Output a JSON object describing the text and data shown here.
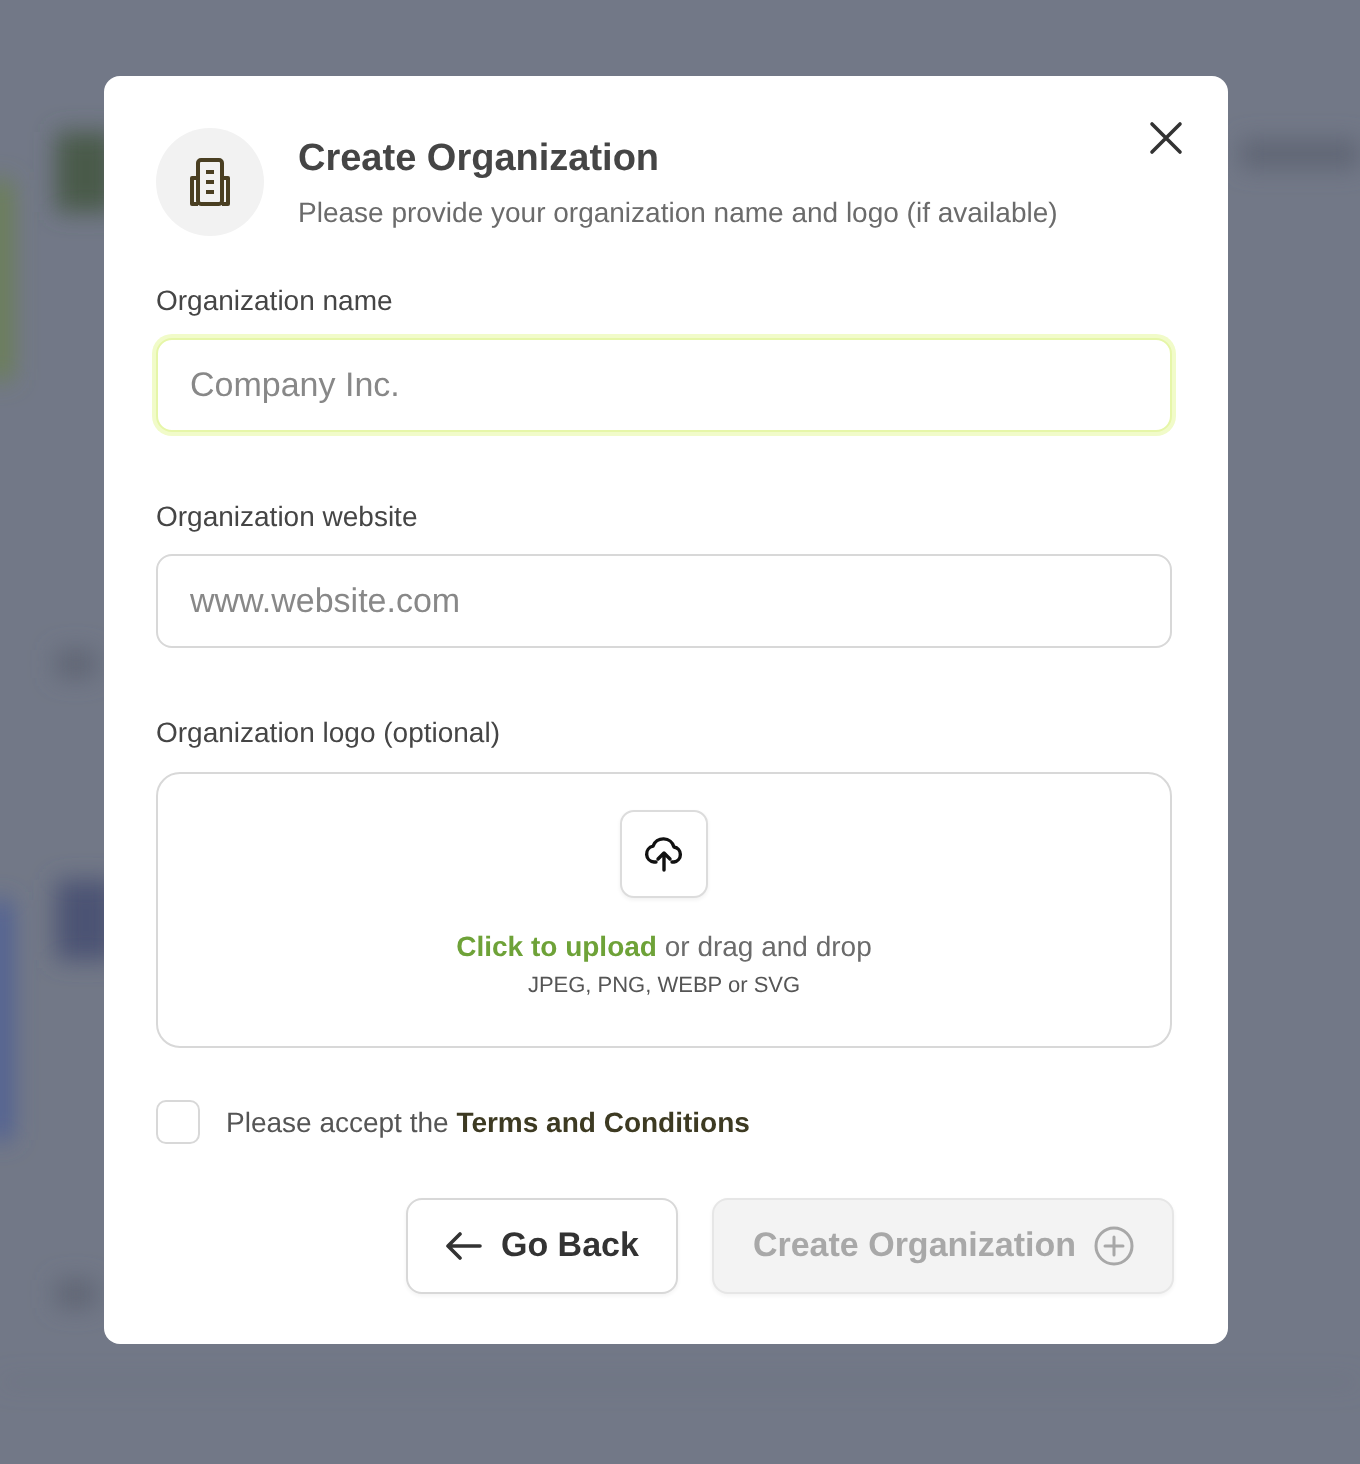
{
  "dialog": {
    "title": "Create Organization",
    "subtitle": "Please provide your organization name and logo (if available)",
    "fields": [
      {
        "label": "Organization name",
        "placeholder": "Company Inc.",
        "focused": true
      },
      {
        "label": "Organization website",
        "placeholder": "www.website.com",
        "focused": false
      }
    ],
    "upload": {
      "label": "Organization logo (optional)",
      "link": "Click to upload",
      "text": "or drag and drop",
      "formats": "JPEG, PNG, WEBP or SVG"
    },
    "consent": {
      "text": "Please accept the",
      "link": "Terms and Conditions",
      "checked": false
    },
    "buttons": [
      {
        "kind": "back",
        "label": "Go Back",
        "disabled": false
      },
      {
        "kind": "create",
        "label": "Create Organization",
        "disabled": true
      }
    ]
  }
}
